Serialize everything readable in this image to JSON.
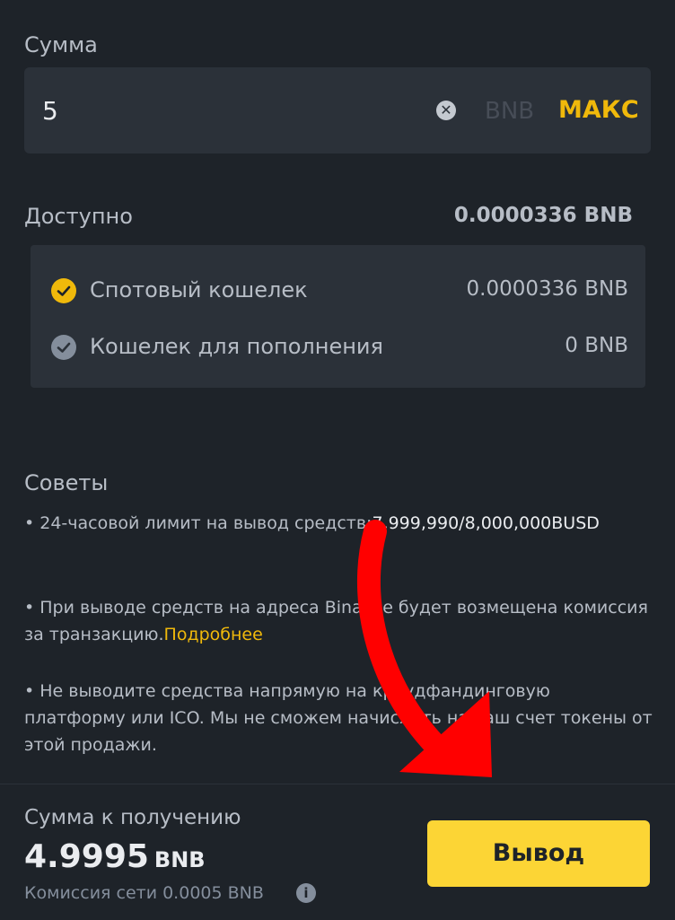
{
  "amount": {
    "label": "Сумма",
    "value": "5",
    "unit": "BNB",
    "max_label": "МАКС"
  },
  "available": {
    "label": "Доступно",
    "value": "0.0000336 BNB"
  },
  "wallets": [
    {
      "name": "Спотовый кошелек",
      "amount": "0.0000336 BNB",
      "selected": true
    },
    {
      "name": "Кошелек для пополнения",
      "amount": "0 BNB",
      "selected": false
    }
  ],
  "tips": {
    "title": "Советы",
    "tip1_prefix": "• 24-часовой лимит на вывод средств:",
    "tip1_value": "7,999,990/8,000,000BUSD",
    "tip2_text": "• При выводе средств на адреса Binance будет возмещена комиссия за транзакцию.",
    "tip2_link": "Подробнее",
    "tip3_text": "• Не выводите средства напрямую на краудфандинговую платформу или ICO. Мы не сможем начислить на ваш счет токены от этой продажи."
  },
  "receive": {
    "label": "Сумма к получению",
    "value": "4.9995",
    "unit": "BNB",
    "fee": "Комиссия сети 0.0005 BNB"
  },
  "withdraw_button": "Вывод",
  "colors": {
    "background": "#1e2329",
    "panel": "#2b3139",
    "accent": "#f0b90b",
    "button": "#fcd535",
    "arrow": "#ff0000"
  }
}
